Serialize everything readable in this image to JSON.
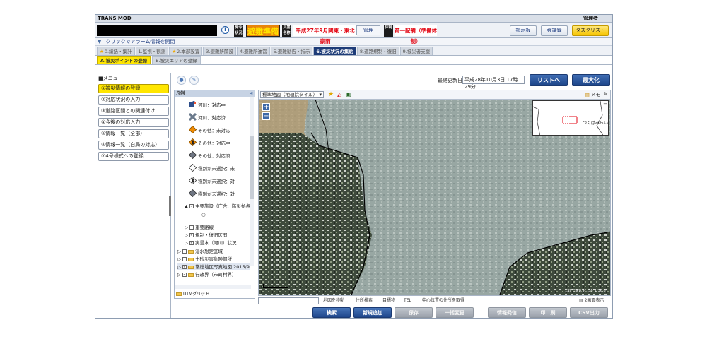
{
  "app": {
    "title": "TRANS MOD",
    "user_role": "管理者"
  },
  "status": {
    "info_icon": "info-icon",
    "label_announce": "発令状況",
    "alert_level": "避難準備",
    "label_disaster": "災害名称",
    "disaster_name": "平成27年9月関東・東北豪雨",
    "manage_button": "管理",
    "label_system": "体制",
    "system_level": "第一配備（準備体制）",
    "buttons": [
      "掲示板",
      "会議録",
      "タスクリスト"
    ]
  },
  "alarm": {
    "text": "クリックでアラーム情報を開閉"
  },
  "tabs": [
    {
      "label": "0.総括・集計",
      "star": true
    },
    {
      "label": "1.監視・観測",
      "star": false
    },
    {
      "label": "2.本部設置",
      "star": true
    },
    {
      "label": "3.避難所開設",
      "star": false
    },
    {
      "label": "4.避難所運営",
      "star": false
    },
    {
      "label": "5.避難勧告・指示",
      "star": false
    },
    {
      "label": "6.被災状況の集約",
      "star": false,
      "active": true
    },
    {
      "label": "8.道路規制・復旧",
      "star": false
    },
    {
      "label": "9.被災者支援",
      "star": false
    }
  ],
  "subtabs": [
    {
      "label": "A.被災ポイントの登録",
      "active": true
    },
    {
      "label": "B.被災エリアの登録",
      "active": false
    }
  ],
  "menu": {
    "title": "■メニュー",
    "items": [
      "①被災情報の登録",
      "②対応状況の入力",
      "③道路区間との関連付け",
      "④今後の対応入力",
      "⑤情報一覧（全部）",
      "⑥情報一覧（自局の対応）",
      "⑦4号様式への登録"
    ]
  },
  "toolbar": {
    "update_label": "最終更新日",
    "update_value": "平成28年10月3日 17時29分",
    "list_button": "リストへ",
    "maximize_button": "最大化"
  },
  "legend": {
    "title": "凡例",
    "items": [
      {
        "label": "河川：対応中",
        "icon": "person-flag-icon"
      },
      {
        "label": "河川：対応済",
        "icon": "x-mark-icon"
      },
      {
        "label": "その他：未対応",
        "icon": "orange-diamond-icon"
      },
      {
        "label": "その他：対応中",
        "icon": "orange-diamond-person-icon"
      },
      {
        "label": "その他：対応済",
        "icon": "gray-diamond-icon"
      },
      {
        "label": "種別が未選択：未",
        "icon": "white-diamond-icon"
      },
      {
        "label": "種別が未選択：対",
        "icon": "white-diamond-person-icon"
      },
      {
        "label": "種別が未選択：対",
        "icon": "gray-diamond-icon"
      }
    ],
    "tree": [
      {
        "label": "主要施設（庁舎、防災拠点",
        "checked": true
      },
      {
        "label": "重要路線",
        "checked": false
      },
      {
        "label": "規制・復旧区間",
        "checked": true
      },
      {
        "label": "実浸水（河川）状況",
        "checked": true
      },
      {
        "label": "浸水想定区域",
        "checked": false
      },
      {
        "label": "土砂災害危険個所",
        "checked": false
      },
      {
        "label": "常総地区写真地図 2015/9",
        "checked": true
      },
      {
        "label": "行政界（市町村界）",
        "checked": true
      }
    ],
    "utm_label": "UTMグリッド"
  },
  "map": {
    "type_select": "標準地図（地理院タイル）",
    "memo_label": "メモ",
    "zoom_in": "+",
    "zoom_out": "−",
    "overview_city": "つくばみらい",
    "copyright": "139°59'8.9\", 36°1'36.8\""
  },
  "map_bottom": {
    "address_move": "地図を移動",
    "address_search": "住所検索",
    "building": "目標物",
    "tel": "TEL",
    "center_address": "中心位置の住所を取得",
    "two_screen": "2画面表示"
  },
  "actions": [
    "検索",
    "新規追加",
    "保存",
    "一括変更",
    "情報発信",
    "印　刷",
    "CSV出力"
  ],
  "colors": {
    "accent": "#1e3c78",
    "highlight": "#ffe600",
    "alert": "#e8850c",
    "danger": "#e30613"
  }
}
